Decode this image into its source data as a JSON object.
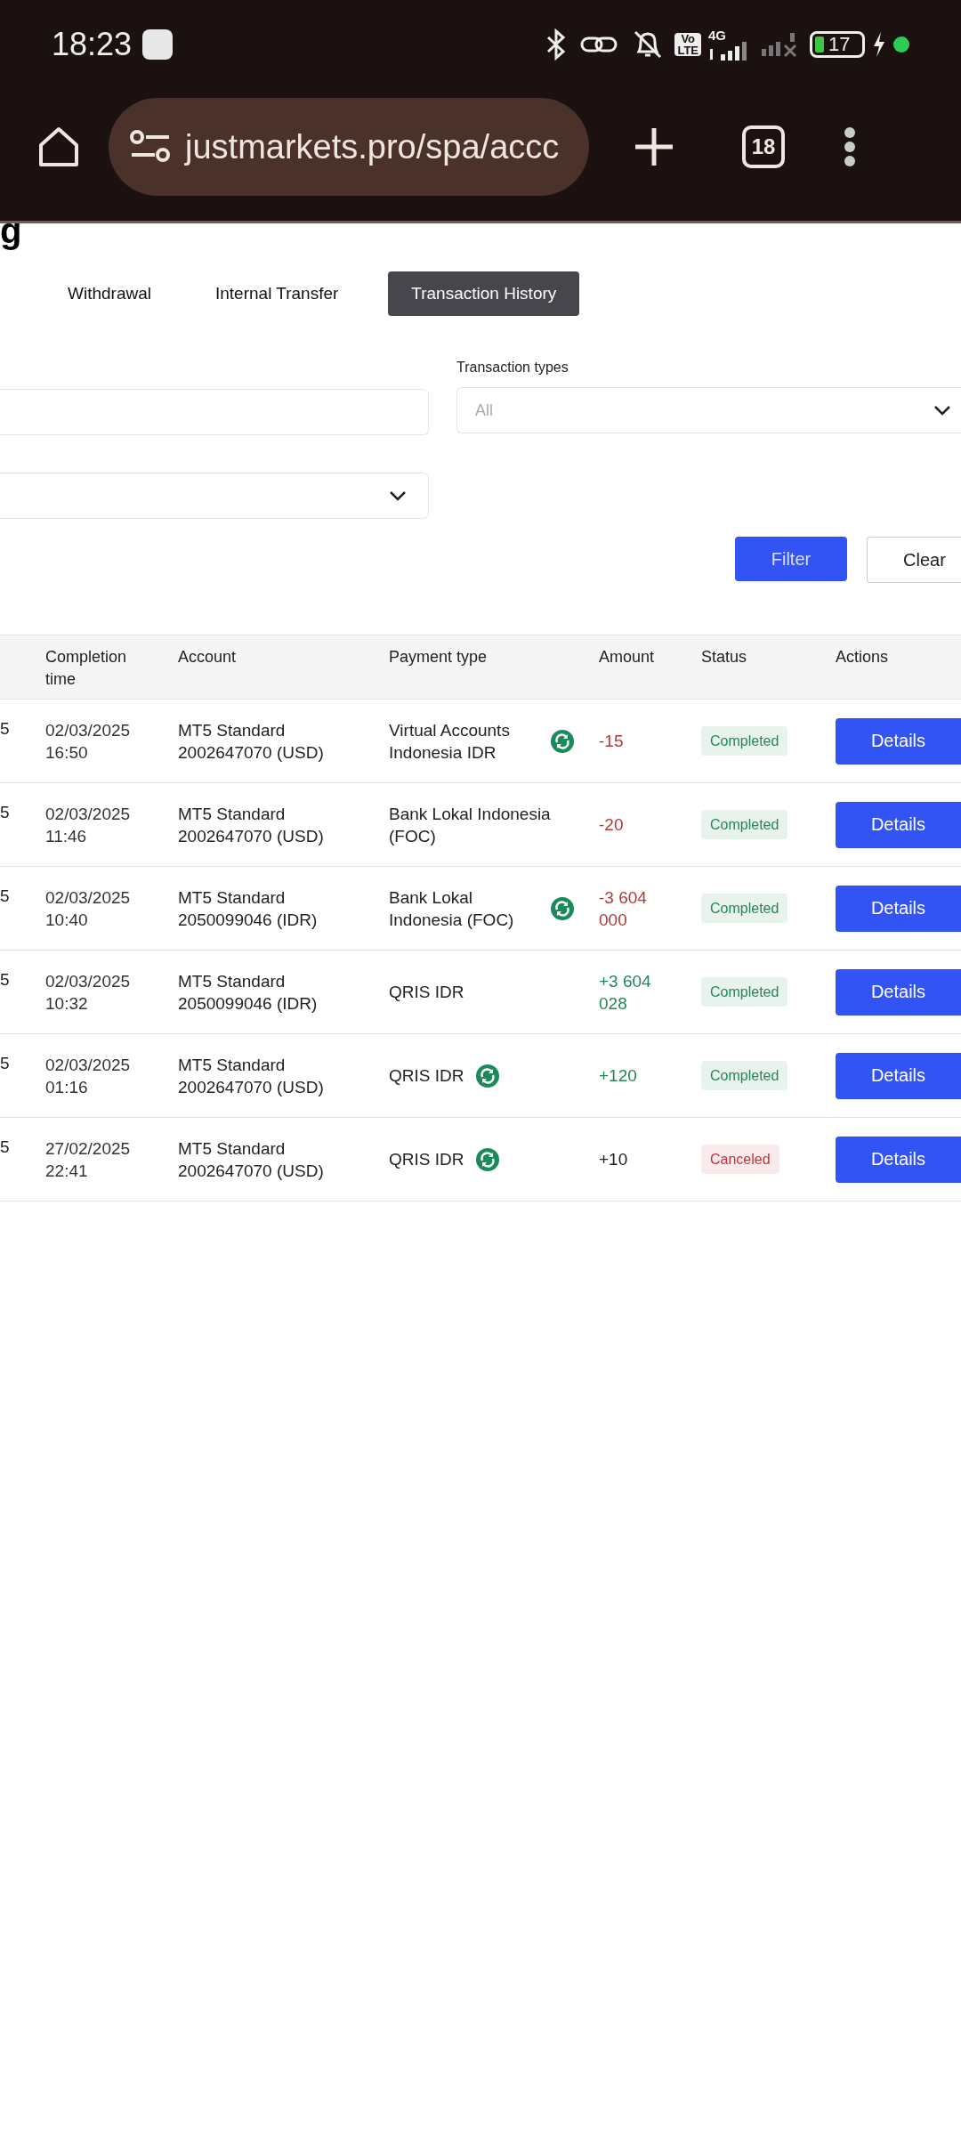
{
  "status_bar": {
    "time": "18:23",
    "volte": [
      "Vo",
      "LTE"
    ],
    "network": "4G",
    "battery": "17"
  },
  "browser": {
    "url": "justmarkets.pro/spa/accc",
    "tab_count": "18"
  },
  "page_title": "g",
  "tabs": [
    {
      "label": "Withdrawal",
      "selected": false
    },
    {
      "label": "Internal Transfer",
      "selected": false
    },
    {
      "label": "Transaction History",
      "selected": true
    }
  ],
  "filters": {
    "transaction_types": {
      "label": "Transaction types",
      "placeholder": "All"
    }
  },
  "buttons": {
    "filter": "Filter",
    "clear": "Clear"
  },
  "table": {
    "columns": [
      "Completion time",
      "Account",
      "Payment type",
      "Amount",
      "Status",
      "Actions"
    ],
    "rows": [
      {
        "column_1": "5",
        "completion_time": "02/03/2025 16:50",
        "account": "MT5 Standard 2002647070 (USD)",
        "payment_type": "Virtual Accounts Indonesia IDR",
        "payment_icon": true,
        "amount": {
          "text": "-15",
          "color": "#b33a3a"
        },
        "status": {
          "text": "Completed",
          "color": "#23875a"
        },
        "action": "Details"
      },
      {
        "column_1": "5",
        "completion_time": "02/03/2025 11:46",
        "account": "MT5 Standard 2002647070 (USD)",
        "payment_type": "Bank Lokal Indonesia (FOC)",
        "payment_icon": false,
        "amount": {
          "text": "-20",
          "color": "#b33a3a"
        },
        "status": {
          "text": "Completed",
          "color": "#23875a"
        },
        "action": "Details"
      },
      {
        "column_1": "5",
        "completion_time": "02/03/2025 10:40",
        "account": "MT5 Standard 2050099046 (IDR)",
        "payment_type": "Bank Lokal Indonesia (FOC)",
        "payment_icon": true,
        "amount": {
          "text": "-3 604 000",
          "color": "#b33a3a"
        },
        "status": {
          "text": "Completed",
          "color": "#23875a"
        },
        "action": "Details"
      },
      {
        "column_1": "5",
        "completion_time": "02/03/2025 10:32",
        "account": "MT5 Standard 2050099046 (IDR)",
        "payment_type": "QRIS IDR",
        "payment_icon": false,
        "amount": {
          "text": "+3 604 028",
          "color": "#23875a"
        },
        "status": {
          "text": "Completed",
          "color": "#23875a"
        },
        "action": "Details"
      },
      {
        "column_1": "5",
        "completion_time": "02/03/2025 01:16",
        "account": "MT5 Standard 2002647070 (USD)",
        "payment_type": "QRIS IDR",
        "payment_icon": true,
        "amount": {
          "text": "+120",
          "color": "#23875a"
        },
        "status": {
          "text": "Completed",
          "color": "#23875a"
        },
        "action": "Details"
      },
      {
        "column_1": "5",
        "completion_time": "27/02/2025 22:41",
        "account": "MT5 Standard 2002647070 (USD)",
        "payment_type": "QRIS IDR",
        "payment_icon": true,
        "amount": {
          "text": "+10",
          "color": "#222222"
        },
        "status": {
          "text": "Canceled",
          "color": "#c4323c"
        },
        "action": "Details"
      }
    ]
  }
}
